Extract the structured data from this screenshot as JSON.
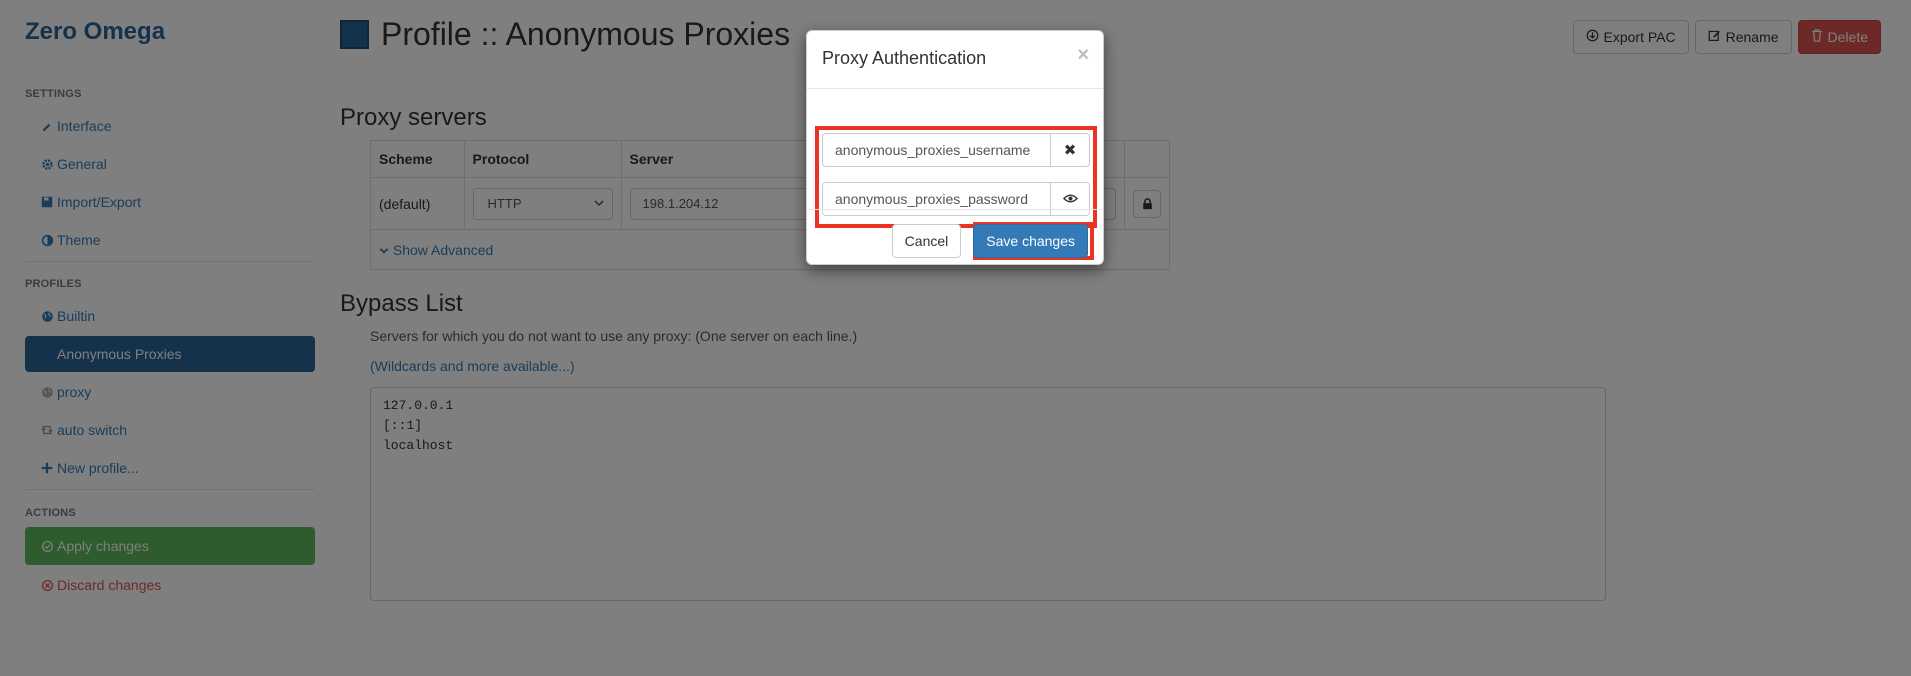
{
  "sidebar": {
    "brand": "Zero Omega",
    "settings_header": "SETTINGS",
    "settings_items": [
      {
        "label": "Interface",
        "icon": "wrench-icon"
      },
      {
        "label": "General",
        "icon": "gear-icon"
      },
      {
        "label": "Import/Export",
        "icon": "floppy-icon"
      },
      {
        "label": "Theme",
        "icon": "contrast-icon"
      }
    ],
    "profiles_header": "PROFILES",
    "profile_items": [
      {
        "label": "Builtin",
        "icon": "globe-icon"
      },
      {
        "label": "Anonymous Proxies",
        "icon": "square-icon",
        "active": true
      },
      {
        "label": "proxy",
        "icon": "globe-icon"
      },
      {
        "label": "auto switch",
        "icon": "retweet-icon"
      },
      {
        "label": "New profile...",
        "icon": "plus-icon"
      }
    ],
    "actions_header": "ACTIONS",
    "apply_label": "Apply changes",
    "discard_label": "Discard changes"
  },
  "header": {
    "title": "Profile :: Anonymous Proxies",
    "export_label": "Export PAC",
    "rename_label": "Rename",
    "delete_label": "Delete"
  },
  "proxy_servers": {
    "heading": "Proxy servers",
    "columns": [
      "Scheme",
      "Protocol",
      "Server"
    ],
    "row": {
      "scheme": "(default)",
      "protocol": "HTTP",
      "server": "198.1.204.12"
    },
    "show_advanced": "Show Advanced"
  },
  "bypass": {
    "heading": "Bypass List",
    "description": "Servers for which you do not want to use any proxy: (One server on each line.)",
    "link": "(Wildcards and more available...)",
    "content": "127.0.0.1\n[::1]\nlocalhost"
  },
  "modal": {
    "title": "Proxy Authentication",
    "close": "×",
    "username": "anonymous_proxies_username",
    "password": "anonymous_proxies_password",
    "clear_icon": "✖",
    "eye_icon": "👁",
    "cancel_label": "Cancel",
    "save_label": "Save changes"
  },
  "colors": {
    "highlight": "#ea3323",
    "primary": "#337ab7",
    "success": "#5cb85c",
    "danger": "#d9534f"
  }
}
